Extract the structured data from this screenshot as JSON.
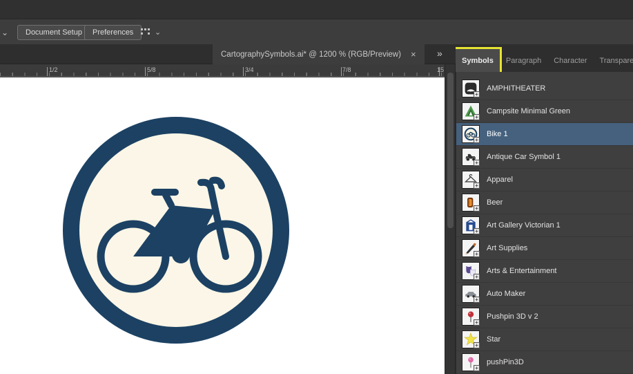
{
  "colors": {
    "navy": "#1c4163",
    "cream": "#fbf6e7",
    "selection_blue": "#45617e",
    "highlight_yellow": "#e6e432"
  },
  "toolbar": {
    "left_chevron": "⌄",
    "document_setup_label": "Document Setup",
    "preferences_label": "Preferences",
    "icon_chevron": "⌄"
  },
  "document_tab": {
    "title": "CartographySymbols.ai* @ 1200 % (RGB/Preview)",
    "close": "×",
    "overflow": "»"
  },
  "panel_tabs": [
    {
      "label": "Symbols",
      "active": true
    },
    {
      "label": "Paragraph",
      "active": false
    },
    {
      "label": "Character",
      "active": false
    },
    {
      "label": "Transparency",
      "active": false
    }
  ],
  "ruler": {
    "labels": [
      "1/2",
      "5/8",
      "3/4",
      "7/8",
      "15"
    ]
  },
  "symbol_badge": "+",
  "symbols_list": [
    {
      "label": "AMPHITHEATER",
      "icon": "amphitheater",
      "selected": false
    },
    {
      "label": "Campsite Minimal Green",
      "icon": "campsite",
      "selected": false
    },
    {
      "label": "Bike 1",
      "icon": "bike",
      "selected": true
    },
    {
      "label": "Antique Car Symbol 1",
      "icon": "antique-car",
      "selected": false
    },
    {
      "label": "Apparel",
      "icon": "hanger",
      "selected": false
    },
    {
      "label": "Beer",
      "icon": "beer",
      "selected": false
    },
    {
      "label": "Art Gallery Victorian 1",
      "icon": "gallery",
      "selected": false
    },
    {
      "label": "Art Supplies",
      "icon": "art-supplies",
      "selected": false
    },
    {
      "label": "Arts & Entertainment",
      "icon": "masks",
      "selected": false
    },
    {
      "label": "Auto Maker",
      "icon": "car",
      "selected": false
    },
    {
      "label": "Pushpin 3D v 2",
      "icon": "pushpin-red",
      "selected": false
    },
    {
      "label": "Star",
      "icon": "star",
      "selected": false
    },
    {
      "label": "pushPin3D",
      "icon": "pushpin-pink",
      "selected": false
    }
  ]
}
